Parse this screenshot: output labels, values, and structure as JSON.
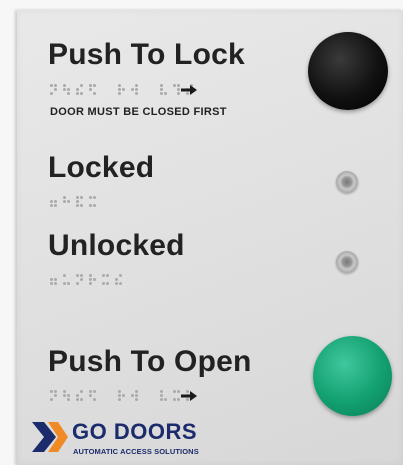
{
  "panel": {
    "push_to_lock": "Push To Lock",
    "door_note": "DOOR MUST BE CLOSED FIRST",
    "locked": "Locked",
    "unlocked": "Unlocked",
    "push_to_open": "Push To Open"
  },
  "logo": {
    "name": "GO DOORS",
    "tagline": "AUTOMATIC ACCESS SOLUTIONS"
  },
  "colors": {
    "lock_button": "#000000",
    "open_button": "#12a070",
    "brand_blue": "#1b2b6b",
    "brand_orange": "#f08a24"
  }
}
